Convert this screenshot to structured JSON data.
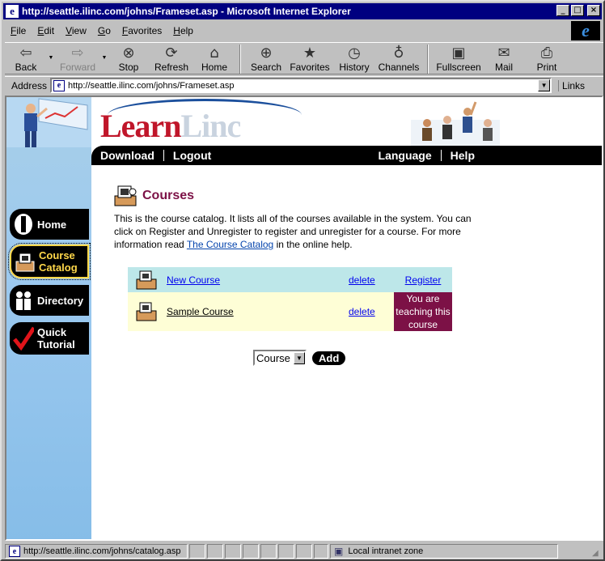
{
  "window": {
    "title": "http://seattle.ilinc.com/johns/Frameset.asp - Microsoft Internet Explorer",
    "controls": [
      "_",
      "□",
      "×"
    ]
  },
  "menu": [
    "File",
    "Edit",
    "View",
    "Go",
    "Favorites",
    "Help"
  ],
  "toolbar": {
    "back": "Back",
    "forward": "Forward",
    "stop": "Stop",
    "refresh": "Refresh",
    "home": "Home",
    "search": "Search",
    "favorites": "Favorites",
    "history": "History",
    "channels": "Channels",
    "fullscreen": "Fullscreen",
    "mail": "Mail",
    "print": "Print"
  },
  "address": {
    "label": "Address",
    "value": "http://seattle.ilinc.com/johns/Frameset.asp",
    "links": "Links"
  },
  "site": {
    "logo_red": "Learn",
    "logo_grey": "Linc",
    "nav_left": [
      "Download",
      "Logout"
    ],
    "nav_right": [
      "Language",
      "Help"
    ]
  },
  "sidebar": [
    {
      "label": "Home",
      "selected": false
    },
    {
      "label": "Course Catalog",
      "selected": true
    },
    {
      "label": "Directory",
      "selected": false
    },
    {
      "label": "Quick Tutorial",
      "selected": false
    }
  ],
  "main": {
    "heading": "Courses",
    "desc_before": "This is the course catalog. It lists all of the courses available in the system. You can click on Register and Unregister to register and unregister for a course. For more information read ",
    "desc_link": "The Course Catalog",
    "desc_after": " in the online help.",
    "courses": [
      {
        "name": "New Course",
        "delete": "delete",
        "action": "Register"
      },
      {
        "name": "Sample Course",
        "delete": "delete",
        "action": "You are teaching this course"
      }
    ],
    "add_select_value": "Course",
    "add_button": "Add"
  },
  "status": {
    "url": "http://seattle.ilinc.com/johns/catalog.asp",
    "zone": "Local intranet zone"
  },
  "colors": {
    "accent": "#7c1146",
    "logo_red": "#c0162a",
    "row_register": "#bde7e9",
    "row_teaching": "#fefed6"
  }
}
